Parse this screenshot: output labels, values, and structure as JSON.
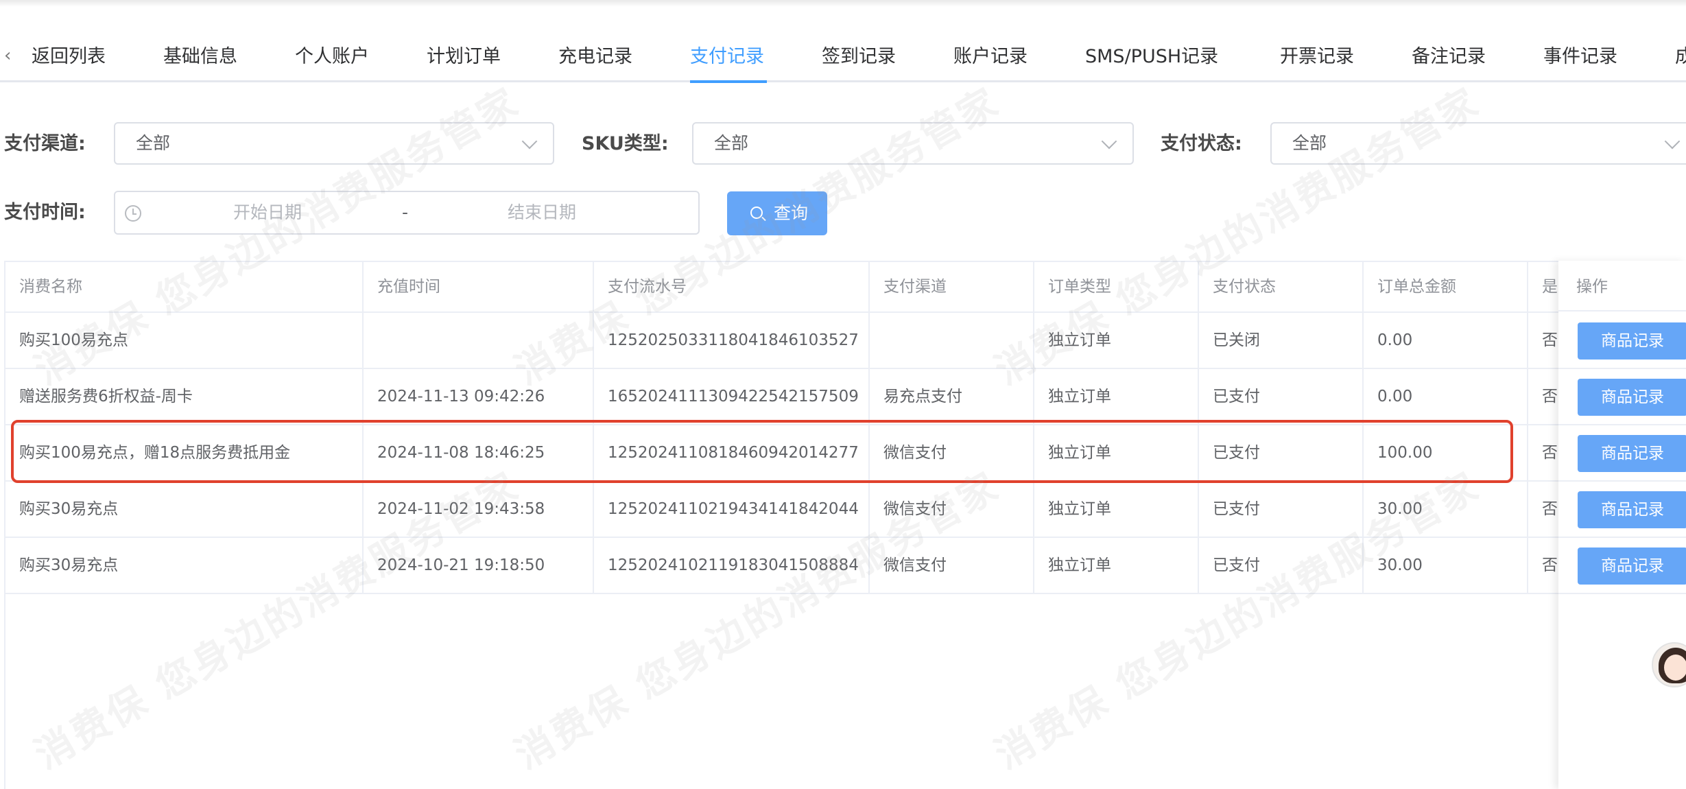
{
  "tabs": [
    {
      "label": "返回列表"
    },
    {
      "label": "基础信息"
    },
    {
      "label": "个人账户"
    },
    {
      "label": "计划订单"
    },
    {
      "label": "充电记录"
    },
    {
      "label": "支付记录"
    },
    {
      "label": "签到记录"
    },
    {
      "label": "账户记录"
    },
    {
      "label": "SMS/PUSH记录"
    },
    {
      "label": "开票记录"
    },
    {
      "label": "备注记录"
    },
    {
      "label": "事件记录"
    },
    {
      "label": "成"
    }
  ],
  "active_tab": "支付记录",
  "filters": {
    "pay_channel_label": "支付渠道:",
    "pay_channel_value": "全部",
    "sku_type_label": "SKU类型:",
    "sku_type_value": "全部",
    "pay_status_label": "支付状态:",
    "pay_status_value": "全部",
    "pay_time_label": "支付时间:",
    "start_placeholder": "开始日期",
    "separator": "-",
    "end_placeholder": "结束日期",
    "query_label": "查询"
  },
  "table": {
    "headers": [
      "消费名称",
      "充值时间",
      "支付流水号",
      "支付渠道",
      "订单类型",
      "支付状态",
      "订单总金额",
      "是否"
    ],
    "op_header": "操作",
    "op_button_label": "商品记录",
    "rows": [
      [
        "购买100易充点",
        "",
        "1252025033118041846103527",
        "",
        "独立订单",
        "已关闭",
        "0.00",
        "否"
      ],
      [
        "赠送服务费6折权益-周卡",
        "2024-11-13 09:42:26",
        "1652024111309422542157509",
        "易充点支付",
        "独立订单",
        "已支付",
        "0.00",
        "否"
      ],
      [
        "购买100易充点，赠18点服务费抵用金",
        "2024-11-08 18:46:25",
        "1252024110818460942014277",
        "微信支付",
        "独立订单",
        "已支付",
        "100.00",
        "否"
      ],
      [
        "购买30易充点",
        "2024-11-02 19:43:58",
        "1252024110219434141842044",
        "微信支付",
        "独立订单",
        "已支付",
        "30.00",
        "否"
      ],
      [
        "购买30易充点",
        "2024-10-21 19:18:50",
        "1252024102119183041508884",
        "微信支付",
        "独立订单",
        "已支付",
        "30.00",
        "否"
      ]
    ]
  },
  "watermark_text": "消费保 您身边的消费服务管家",
  "colors": {
    "accent": "#409eff",
    "button": "#66a6f7",
    "highlight": "#e0412d"
  }
}
